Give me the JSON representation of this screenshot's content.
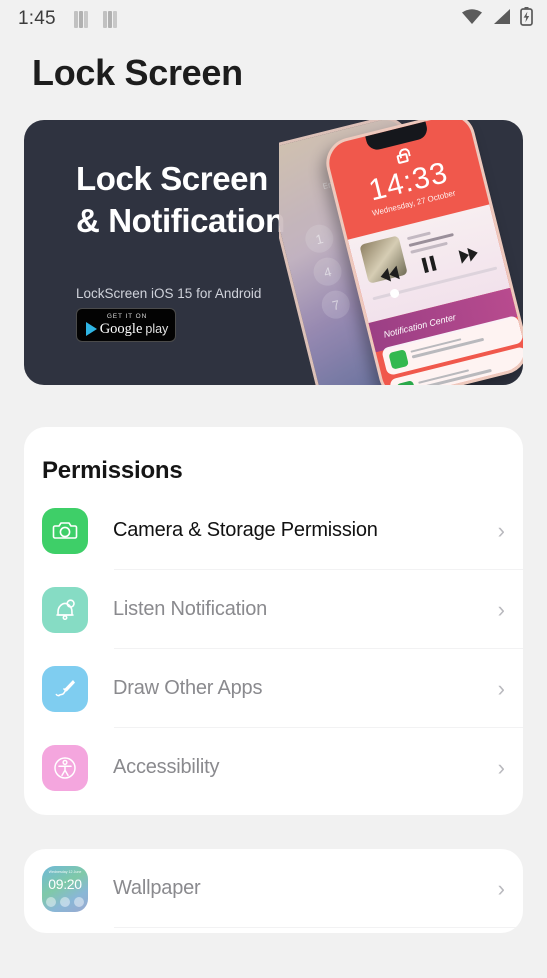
{
  "statusbar": {
    "time": "1:45",
    "notification_icons": [
      "app-icon",
      "app-icon"
    ],
    "right_icons": [
      "wifi-icon",
      "cellular-signal-icon",
      "battery-charging-icon"
    ]
  },
  "header": {
    "title": "Lock Screen"
  },
  "banner": {
    "line1": "Lock Screen",
    "line2": "& Notification",
    "subtitle": "LockScreen iOS 15 for Android",
    "store_badge": {
      "top": "GET IT ON",
      "name": "Google",
      "suffix": "play"
    },
    "background_color": "#2f3340",
    "phone_preview": {
      "time": "14:33",
      "date": "Wednesday, 27 October",
      "screen_color": "#f0584c",
      "notification_center_label": "Notification Center",
      "back_phone_label": "Enter Passcode",
      "keypad": [
        "1",
        "4",
        "7"
      ]
    }
  },
  "permissions_card": {
    "title": "Permissions",
    "items": [
      {
        "label": "Camera & Storage Permission",
        "icon": "camera-icon",
        "icon_color": "#3ecf68",
        "granted": true
      },
      {
        "label": "Listen Notification",
        "icon": "bell-icon",
        "icon_color": "#86dcc4",
        "granted": false
      },
      {
        "label": "Draw Other Apps",
        "icon": "brush-icon",
        "icon_color": "#7fcdf0",
        "granted": false
      },
      {
        "label": "Accessibility",
        "icon": "accessibility-icon",
        "icon_color": "#f4a6de",
        "granted": false
      }
    ]
  },
  "settings_card": {
    "items": [
      {
        "label": "Wallpaper",
        "icon": "wallpaper-thumbnail-icon",
        "thumb_time": "09:20",
        "thumb_top": "Wednesday 12 June"
      }
    ]
  },
  "chevron": "›"
}
